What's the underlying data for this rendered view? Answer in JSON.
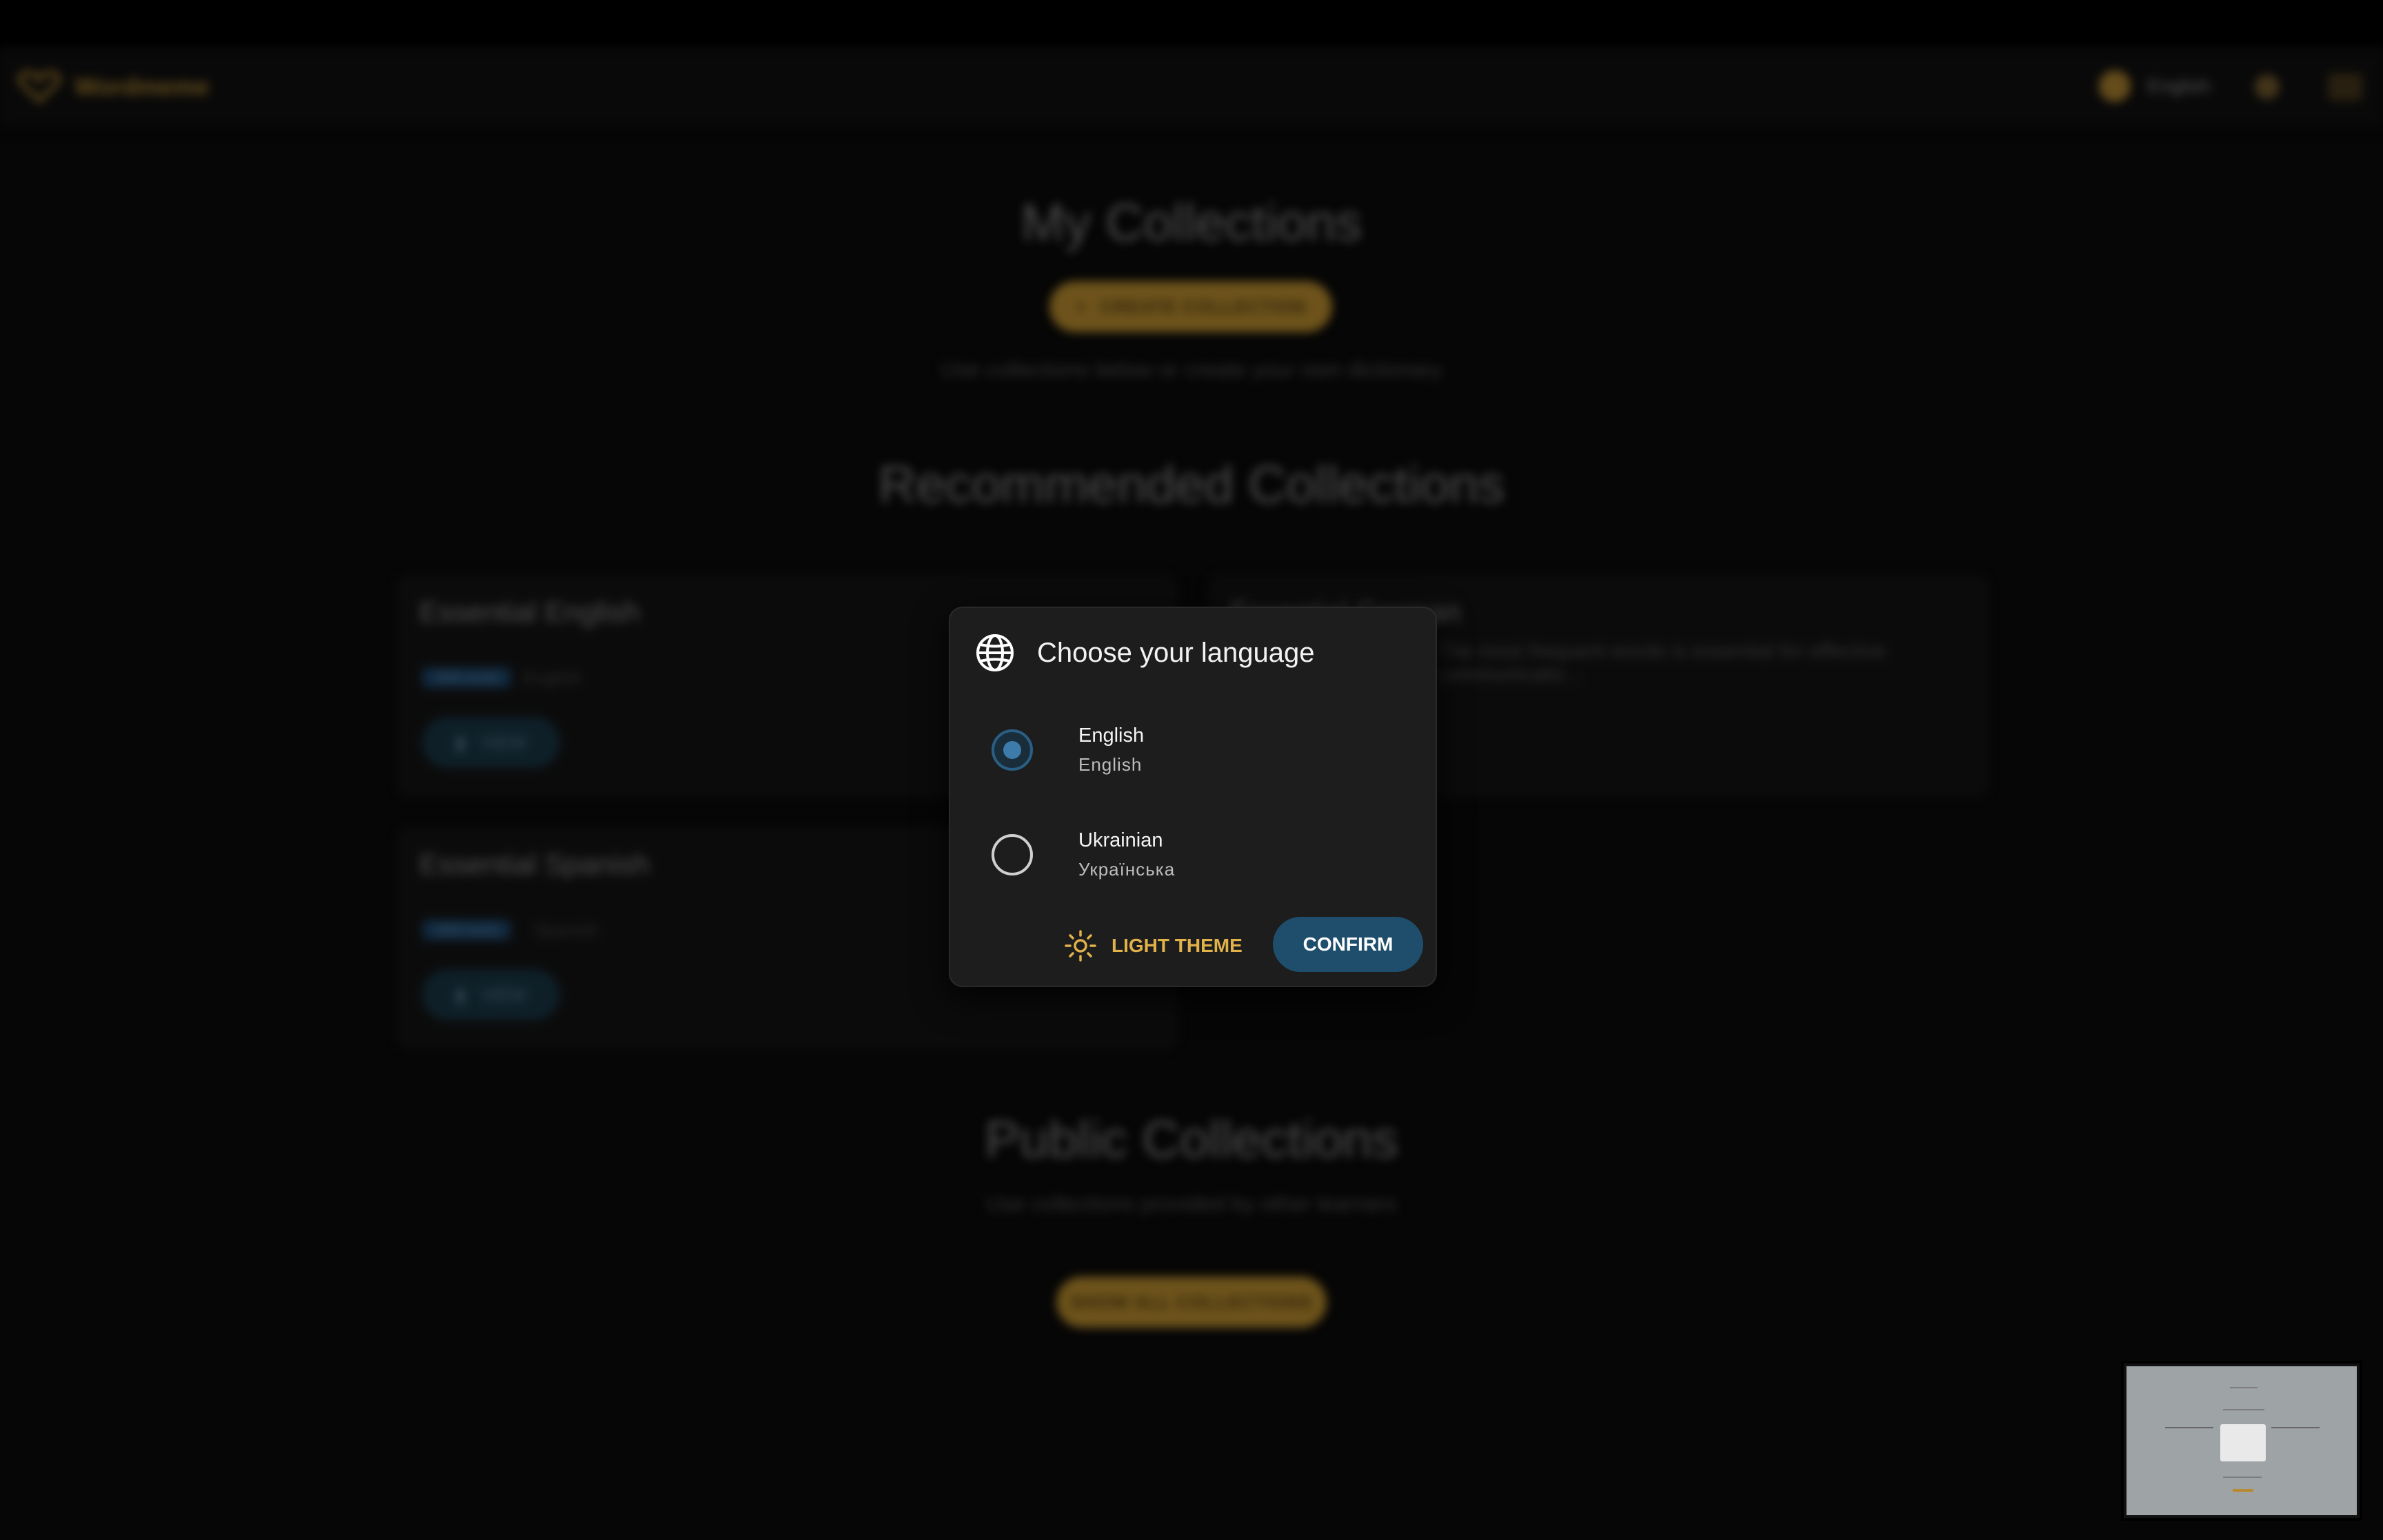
{
  "app": {
    "name": "Wordmeme"
  },
  "header": {
    "language_label": "English"
  },
  "my_collections": {
    "title": "My Collections",
    "create_button": "CREATE COLLECTION",
    "subtitle": "Use collections below or create your own dictionary"
  },
  "recommended": {
    "title": "Recommended Collections",
    "cards": [
      {
        "title": "Essential English",
        "tag": "3000 words",
        "language": "English",
        "view_label": "VIEW"
      },
      {
        "title": "Essential German",
        "description": "The most frequent words is essential for effective communicatio..."
      },
      {
        "title": "Essential Spanish",
        "tag": "3000 words",
        "language": "Spanish",
        "view_label": "VIEW"
      }
    ]
  },
  "public_collections": {
    "title": "Public Collections",
    "subtitle": "Use collections provided by other learners",
    "show_all_button": "SHOW ALL COLLECTIONS"
  },
  "dialog": {
    "title": "Choose your language",
    "options": [
      {
        "label": "English",
        "native": "English",
        "selected": true
      },
      {
        "label": "Ukrainian",
        "native": "Українська",
        "selected": false
      }
    ],
    "light_theme_button": "LIGHT THEME",
    "confirm_button": "CONFIRM"
  },
  "icons": {
    "globe": "globe-icon",
    "sun": "sun-icon",
    "logo": "heart-logo"
  },
  "colors": {
    "accent": "#c79832",
    "primary": "#1e4e6c",
    "dialog_bg": "#1d1d1d",
    "page_bg": "#0b0b0b"
  }
}
